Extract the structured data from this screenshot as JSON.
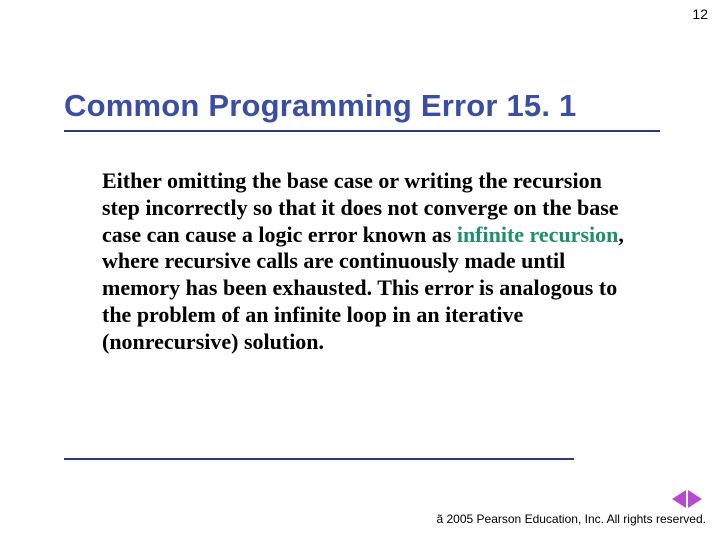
{
  "page_number": "12",
  "heading": "Common Programming Error 15. 1",
  "body": {
    "pre": "Either omitting the base case or writing the recursion step incorrectly so that it does not converge on the base case can cause a logic error known as ",
    "keyword": "infinite recursion",
    "post": ", where recursive calls are continuously made until memory has been exhausted. This error is analogous to the problem of an infinite loop in an iterative (nonrecursive) solution."
  },
  "footer": "ã 2005 Pearson Education, Inc. All rights reserved."
}
